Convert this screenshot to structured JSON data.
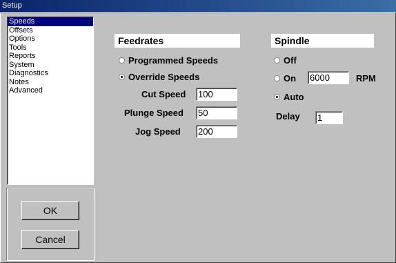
{
  "window": {
    "title": "Setup"
  },
  "sidebar": {
    "items": [
      {
        "label": "Speeds",
        "selected": true
      },
      {
        "label": "Offsets"
      },
      {
        "label": "Options"
      },
      {
        "label": "Tools"
      },
      {
        "label": "Reports"
      },
      {
        "label": "System"
      },
      {
        "label": "Diagnostics"
      },
      {
        "label": "Notes"
      },
      {
        "label": "Advanced"
      }
    ]
  },
  "buttons": {
    "ok_label": "OK",
    "cancel_label": "Cancel"
  },
  "feedrates": {
    "title": "Feedrates",
    "programmed_label": "Programmed Speeds",
    "override_label": "Override Speeds",
    "selected": "override",
    "cut_speed_label": "Cut Speed",
    "cut_speed_value": "100",
    "plunge_speed_label": "Plunge Speed",
    "plunge_speed_value": "50",
    "jog_speed_label": "Jog Speed",
    "jog_speed_value": "200"
  },
  "spindle": {
    "title": "Spindle",
    "off_label": "Off",
    "on_label": "On",
    "on_value": "6000",
    "rpm_label": "RPM",
    "auto_label": "Auto",
    "selected": "auto",
    "delay_label": "Delay",
    "delay_value": "1"
  }
}
